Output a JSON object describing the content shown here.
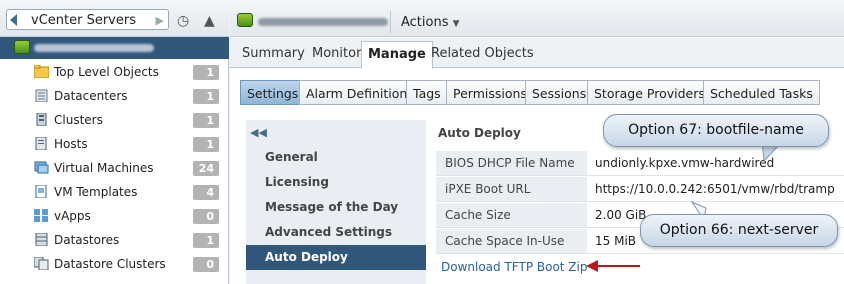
{
  "navigator": {
    "breadcrumb": "vCenter Servers",
    "items": [
      {
        "label": "Top Level Objects",
        "count": "1",
        "icon": "folder-icon"
      },
      {
        "label": "Datacenters",
        "count": "1",
        "icon": "datacenter-icon"
      },
      {
        "label": "Clusters",
        "count": "1",
        "icon": "cluster-icon"
      },
      {
        "label": "Hosts",
        "count": "1",
        "icon": "host-icon"
      },
      {
        "label": "Virtual Machines",
        "count": "24",
        "icon": "vm-icon"
      },
      {
        "label": "VM Templates",
        "count": "4",
        "icon": "template-icon"
      },
      {
        "label": "vApps",
        "count": "0",
        "icon": "vapp-icon"
      },
      {
        "label": "Datastores",
        "count": "1",
        "icon": "datastore-icon"
      },
      {
        "label": "Datastore Clusters",
        "count": "0",
        "icon": "datastore-cluster-icon"
      }
    ]
  },
  "header": {
    "actions_label": "Actions"
  },
  "object_tabs": [
    {
      "label": "Summary",
      "active": false
    },
    {
      "label": "Monitor",
      "active": false
    },
    {
      "label": "Manage",
      "active": true
    },
    {
      "label": "Related Objects",
      "active": false
    }
  ],
  "manage_tabs": [
    {
      "label": "Settings",
      "active": true
    },
    {
      "label": "Alarm Definitions",
      "active": false
    },
    {
      "label": "Tags",
      "active": false
    },
    {
      "label": "Permissions",
      "active": false
    },
    {
      "label": "Sessions",
      "active": false
    },
    {
      "label": "Storage Providers",
      "active": false
    },
    {
      "label": "Scheduled Tasks",
      "active": false
    }
  ],
  "settings_menu": [
    {
      "label": "General",
      "active": false
    },
    {
      "label": "Licensing",
      "active": false
    },
    {
      "label": "Message of the Day",
      "active": false
    },
    {
      "label": "Advanced Settings",
      "active": false
    },
    {
      "label": "Auto Deploy",
      "active": true
    }
  ],
  "auto_deploy": {
    "title": "Auto Deploy",
    "rows": [
      {
        "key": "BIOS DHCP File Name",
        "value": "undionly.kpxe.vmw-hardwired"
      },
      {
        "key": "iPXE Boot URL",
        "value": "https://10.0.0.242:6501/vmw/rbd/tramp"
      },
      {
        "key": "Cache Size",
        "value": "2.00 GiB"
      },
      {
        "key": "Cache Space In-Use",
        "value": "15 MiB"
      }
    ],
    "download_link": "Download TFTP Boot Zip"
  },
  "callouts": {
    "option67": "Option 67: bootfile-name",
    "option66": "Option 66: next-server"
  },
  "colors": {
    "selection": "#31577a",
    "count_badge": "#b3b3b3",
    "link": "#2a62a4",
    "annotation_arrow": "#c0151b"
  }
}
